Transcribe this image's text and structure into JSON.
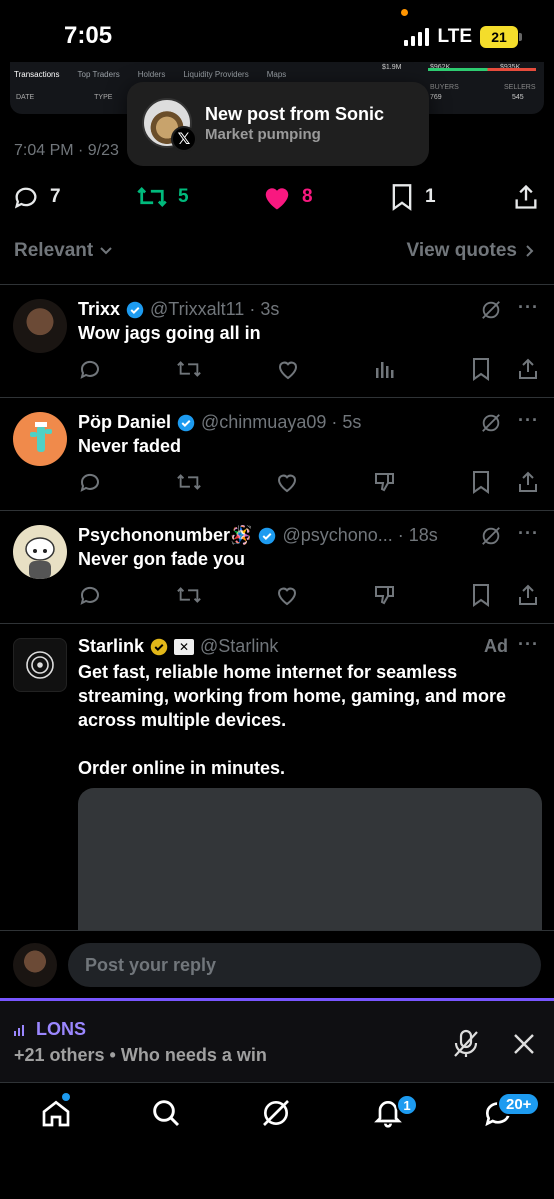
{
  "status": {
    "time": "7:05",
    "network": "LTE",
    "battery": "21"
  },
  "embed": {
    "tabs": [
      "Transactions",
      "Top Traders",
      "Holders",
      "Liquidity Providers",
      "Maps"
    ],
    "subheads": [
      "DATE",
      "TYPE"
    ],
    "right_top": [
      "$1.9M",
      "$962K",
      "$935K"
    ],
    "buyers_label": "BUYERS",
    "sellers_label": "SELLERS",
    "buyers": "769",
    "sellers": "545"
  },
  "toast": {
    "title": "New post from Sonic",
    "subtitle": "Market pumping"
  },
  "post": {
    "timestamp": "7:04 PM · 9/23",
    "replies": "7",
    "reposts": "5",
    "likes": "8",
    "bookmarks": "1"
  },
  "filter": {
    "sort_label": "Relevant",
    "quotes_label": "View quotes"
  },
  "replies": [
    {
      "name": "Trixx",
      "handle": "@Trixxalt11 · 3s",
      "text": "Wow jags going all in"
    },
    {
      "name": "Pöp Daniel",
      "handle": "@chinmuaya09 · 5s",
      "text": "Never faded"
    },
    {
      "name": "Psychononumber🪅",
      "handle": "@psychono... · 18s",
      "text": "Never gon fade you"
    }
  ],
  "ad": {
    "name": "Starlink",
    "handle": "@Starlink",
    "label": "Ad",
    "text": "Get fast, reliable home internet for seamless streaming, working from home, gaming, and more across multiple devices.\n\nOrder online in minutes."
  },
  "composer": {
    "placeholder": "Post your reply"
  },
  "space": {
    "title": "LONS",
    "subtitle": "+21 others • Who needs a win"
  },
  "tabbar": {
    "notifications_badge": "1",
    "messages_badge": "20+"
  },
  "colors": {
    "accent": "#1d9bf0",
    "like": "#f91880",
    "repost": "#00ba7c",
    "space": "#7856ff"
  }
}
